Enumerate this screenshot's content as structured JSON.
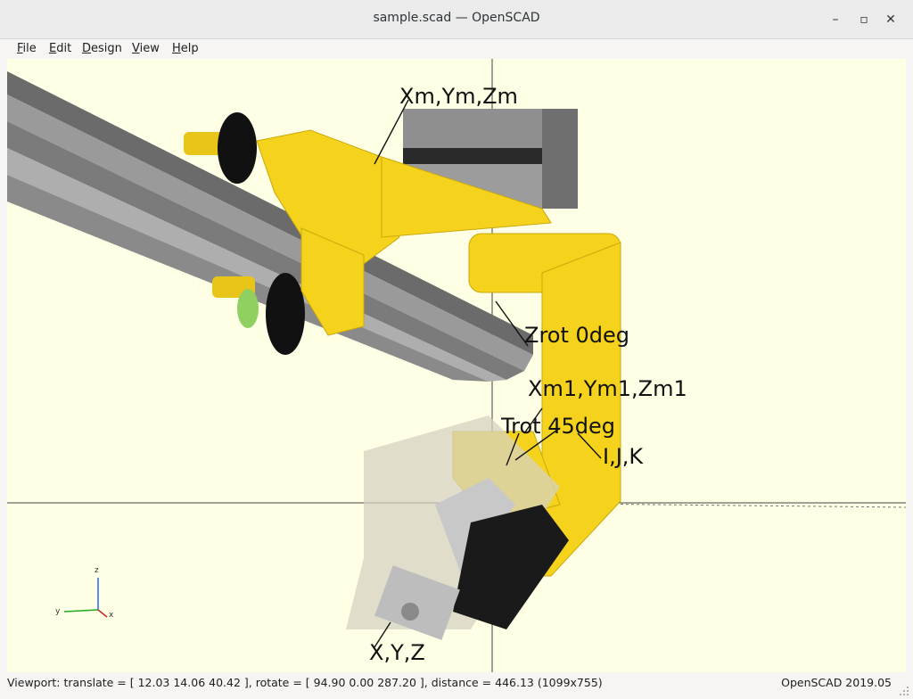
{
  "window": {
    "title": "sample.scad — OpenSCAD",
    "minimize": "–",
    "maximize": "▫",
    "close": "✕"
  },
  "menu": {
    "items": [
      {
        "label": "File",
        "u": "F",
        "rest": "ile"
      },
      {
        "label": "Edit",
        "u": "E",
        "rest": "dit"
      },
      {
        "label": "Design",
        "u": "D",
        "rest": "esign"
      },
      {
        "label": "View",
        "u": "V",
        "rest": "iew"
      },
      {
        "label": "Help",
        "u": "H",
        "rest": "elp"
      }
    ]
  },
  "viewport": {
    "background": "#ffffe5",
    "part_color": "#f5d21c",
    "annotations": {
      "xyz_m": "Xm,Ym,Zm",
      "zrot": "Zrot 0deg",
      "xyz_m1": "Xm1,Ym1,Zm1",
      "trot": "Trot 45deg",
      "ijk": "I,J,K",
      "xyz": "X,Y,Z"
    },
    "axes": {
      "z": "z",
      "y": "y",
      "x": "x"
    }
  },
  "status": {
    "viewport": "Viewport: translate = [ 12.03 14.06 40.42 ], rotate = [ 94.90 0.00 287.20 ], distance = 446.13 (1099x755)",
    "version": "OpenSCAD 2019.05"
  }
}
